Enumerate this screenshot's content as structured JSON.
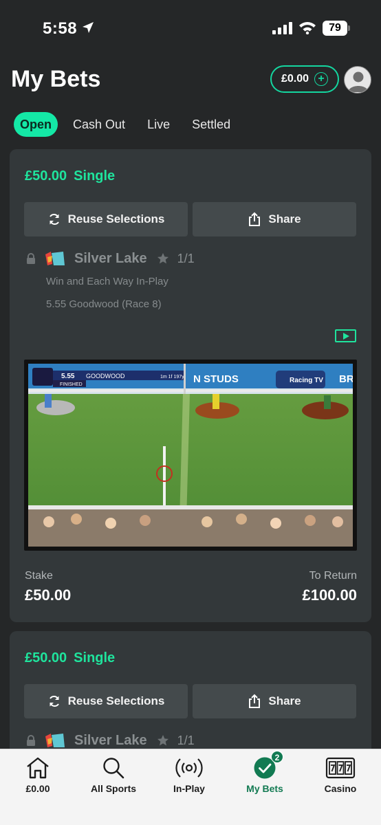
{
  "status_bar": {
    "time": "5:58",
    "battery": "79"
  },
  "header": {
    "title": "My Bets",
    "balance": "£0.00"
  },
  "tabs": [
    {
      "label": "Open",
      "active": true
    },
    {
      "label": "Cash Out",
      "active": false
    },
    {
      "label": "Live",
      "active": false
    },
    {
      "label": "Settled",
      "active": false
    }
  ],
  "bets": [
    {
      "amount": "£50.00",
      "type": "Single",
      "reuse_label": "Reuse Selections",
      "share_label": "Share",
      "selection": "Silver Lake",
      "odds": "1/1",
      "market": "Win and Each Way In-Play",
      "event": "5.55 Goodwood (Race 8)",
      "video_overlay": {
        "time": "5.55",
        "course": "GOODWOOD",
        "distance": "1m 1f 197y",
        "status": "FINISHED",
        "board_text": "N STUDS",
        "channel": "Racing TV",
        "board_text_2": "BR"
      },
      "stake_label": "Stake",
      "stake": "£50.00",
      "return_label": "To Return",
      "to_return": "£100.00"
    },
    {
      "amount": "£50.00",
      "type": "Single",
      "reuse_label": "Reuse Selections",
      "share_label": "Share",
      "selection": "Silver Lake",
      "odds": "1/1"
    }
  ],
  "bottom_nav": [
    {
      "label": "£0.00",
      "icon": "home-icon"
    },
    {
      "label": "All Sports",
      "icon": "search-icon"
    },
    {
      "label": "In-Play",
      "icon": "broadcast-icon"
    },
    {
      "label": "My Bets",
      "icon": "check-circle-icon",
      "badge": "2",
      "active": true
    },
    {
      "label": "Casino",
      "icon": "slot-machine-icon"
    }
  ],
  "colors": {
    "accent": "#1fe49d",
    "background": "#252728",
    "card": "#33383a",
    "nav_active": "#127a52"
  }
}
